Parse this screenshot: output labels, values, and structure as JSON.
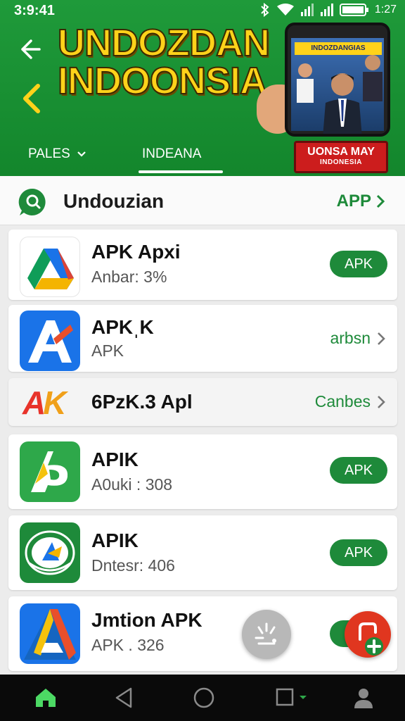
{
  "status": {
    "time": "3:9:41",
    "battery": "1:27"
  },
  "banner": {
    "title_line1": "UNDOZDAN",
    "title_line2": "INDOONSIA",
    "phone_header": "INDOZDANGIAS"
  },
  "tabs": [
    {
      "label": "PALES"
    },
    {
      "label": "INDEANA"
    }
  ],
  "promo": {
    "title": "UONSA MAY",
    "subtitle": "INDONESIA"
  },
  "search": {
    "text": "Undouzian",
    "link": "APP"
  },
  "apps": [
    {
      "name": "APK Apxi",
      "sub": "Anbar: 3%",
      "action": "APK"
    },
    {
      "name": "APKˌK",
      "sub": "APK",
      "action": "arbsn"
    },
    {
      "name": "6PzK.3  Apl",
      "sub": "",
      "action": "Canbes",
      "badge": "AK"
    },
    {
      "name": "APIK",
      "sub": "A0uki : 308",
      "action": "APK"
    },
    {
      "name": "APIK",
      "sub": "Dntesr: 406",
      "action": "APK"
    },
    {
      "name": "Jmtion APK",
      "sub": "APK . 326",
      "action": ""
    }
  ],
  "colors": {
    "brand_green": "#1e8a3a",
    "header_green": "#1a9436",
    "title_yellow": "#ffd21a",
    "promo_red": "#cc1d1d"
  }
}
